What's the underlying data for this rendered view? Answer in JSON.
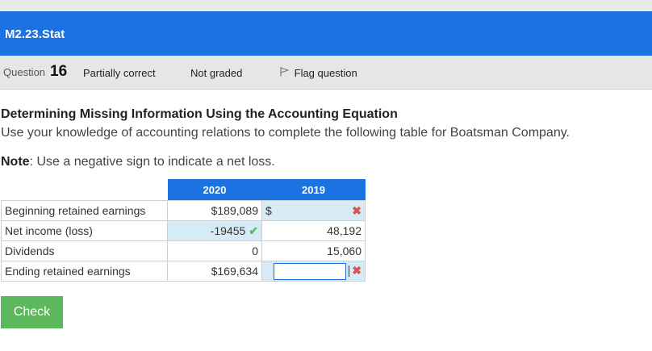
{
  "header": {
    "title": "M2.23.Stat"
  },
  "question_bar": {
    "question_label": "Question",
    "question_number": "16",
    "status": "Partially correct",
    "grade": "Not graded",
    "flag_label": "Flag question"
  },
  "content": {
    "heading": "Determining Missing Information Using the Accounting Equation",
    "instruction": "Use your knowledge of accounting relations to complete the following table for Boatsman Company.",
    "note_label": "Note",
    "note_text": ": Use a negative sign to indicate a net loss."
  },
  "table": {
    "headers": [
      "2020",
      "2019"
    ],
    "rows": [
      {
        "label": "Beginning retained earnings",
        "v2020": "$189,089",
        "v2019_currency": "$",
        "v2019": ""
      },
      {
        "label": "Net income (loss)",
        "v2020": "-19455",
        "v2019": "48,192"
      },
      {
        "label": "Dividends",
        "v2020": "0",
        "v2019": "15,060"
      },
      {
        "label": "Ending retained earnings",
        "v2020": "$169,634",
        "v2019": ""
      }
    ]
  },
  "check_button": "Check"
}
